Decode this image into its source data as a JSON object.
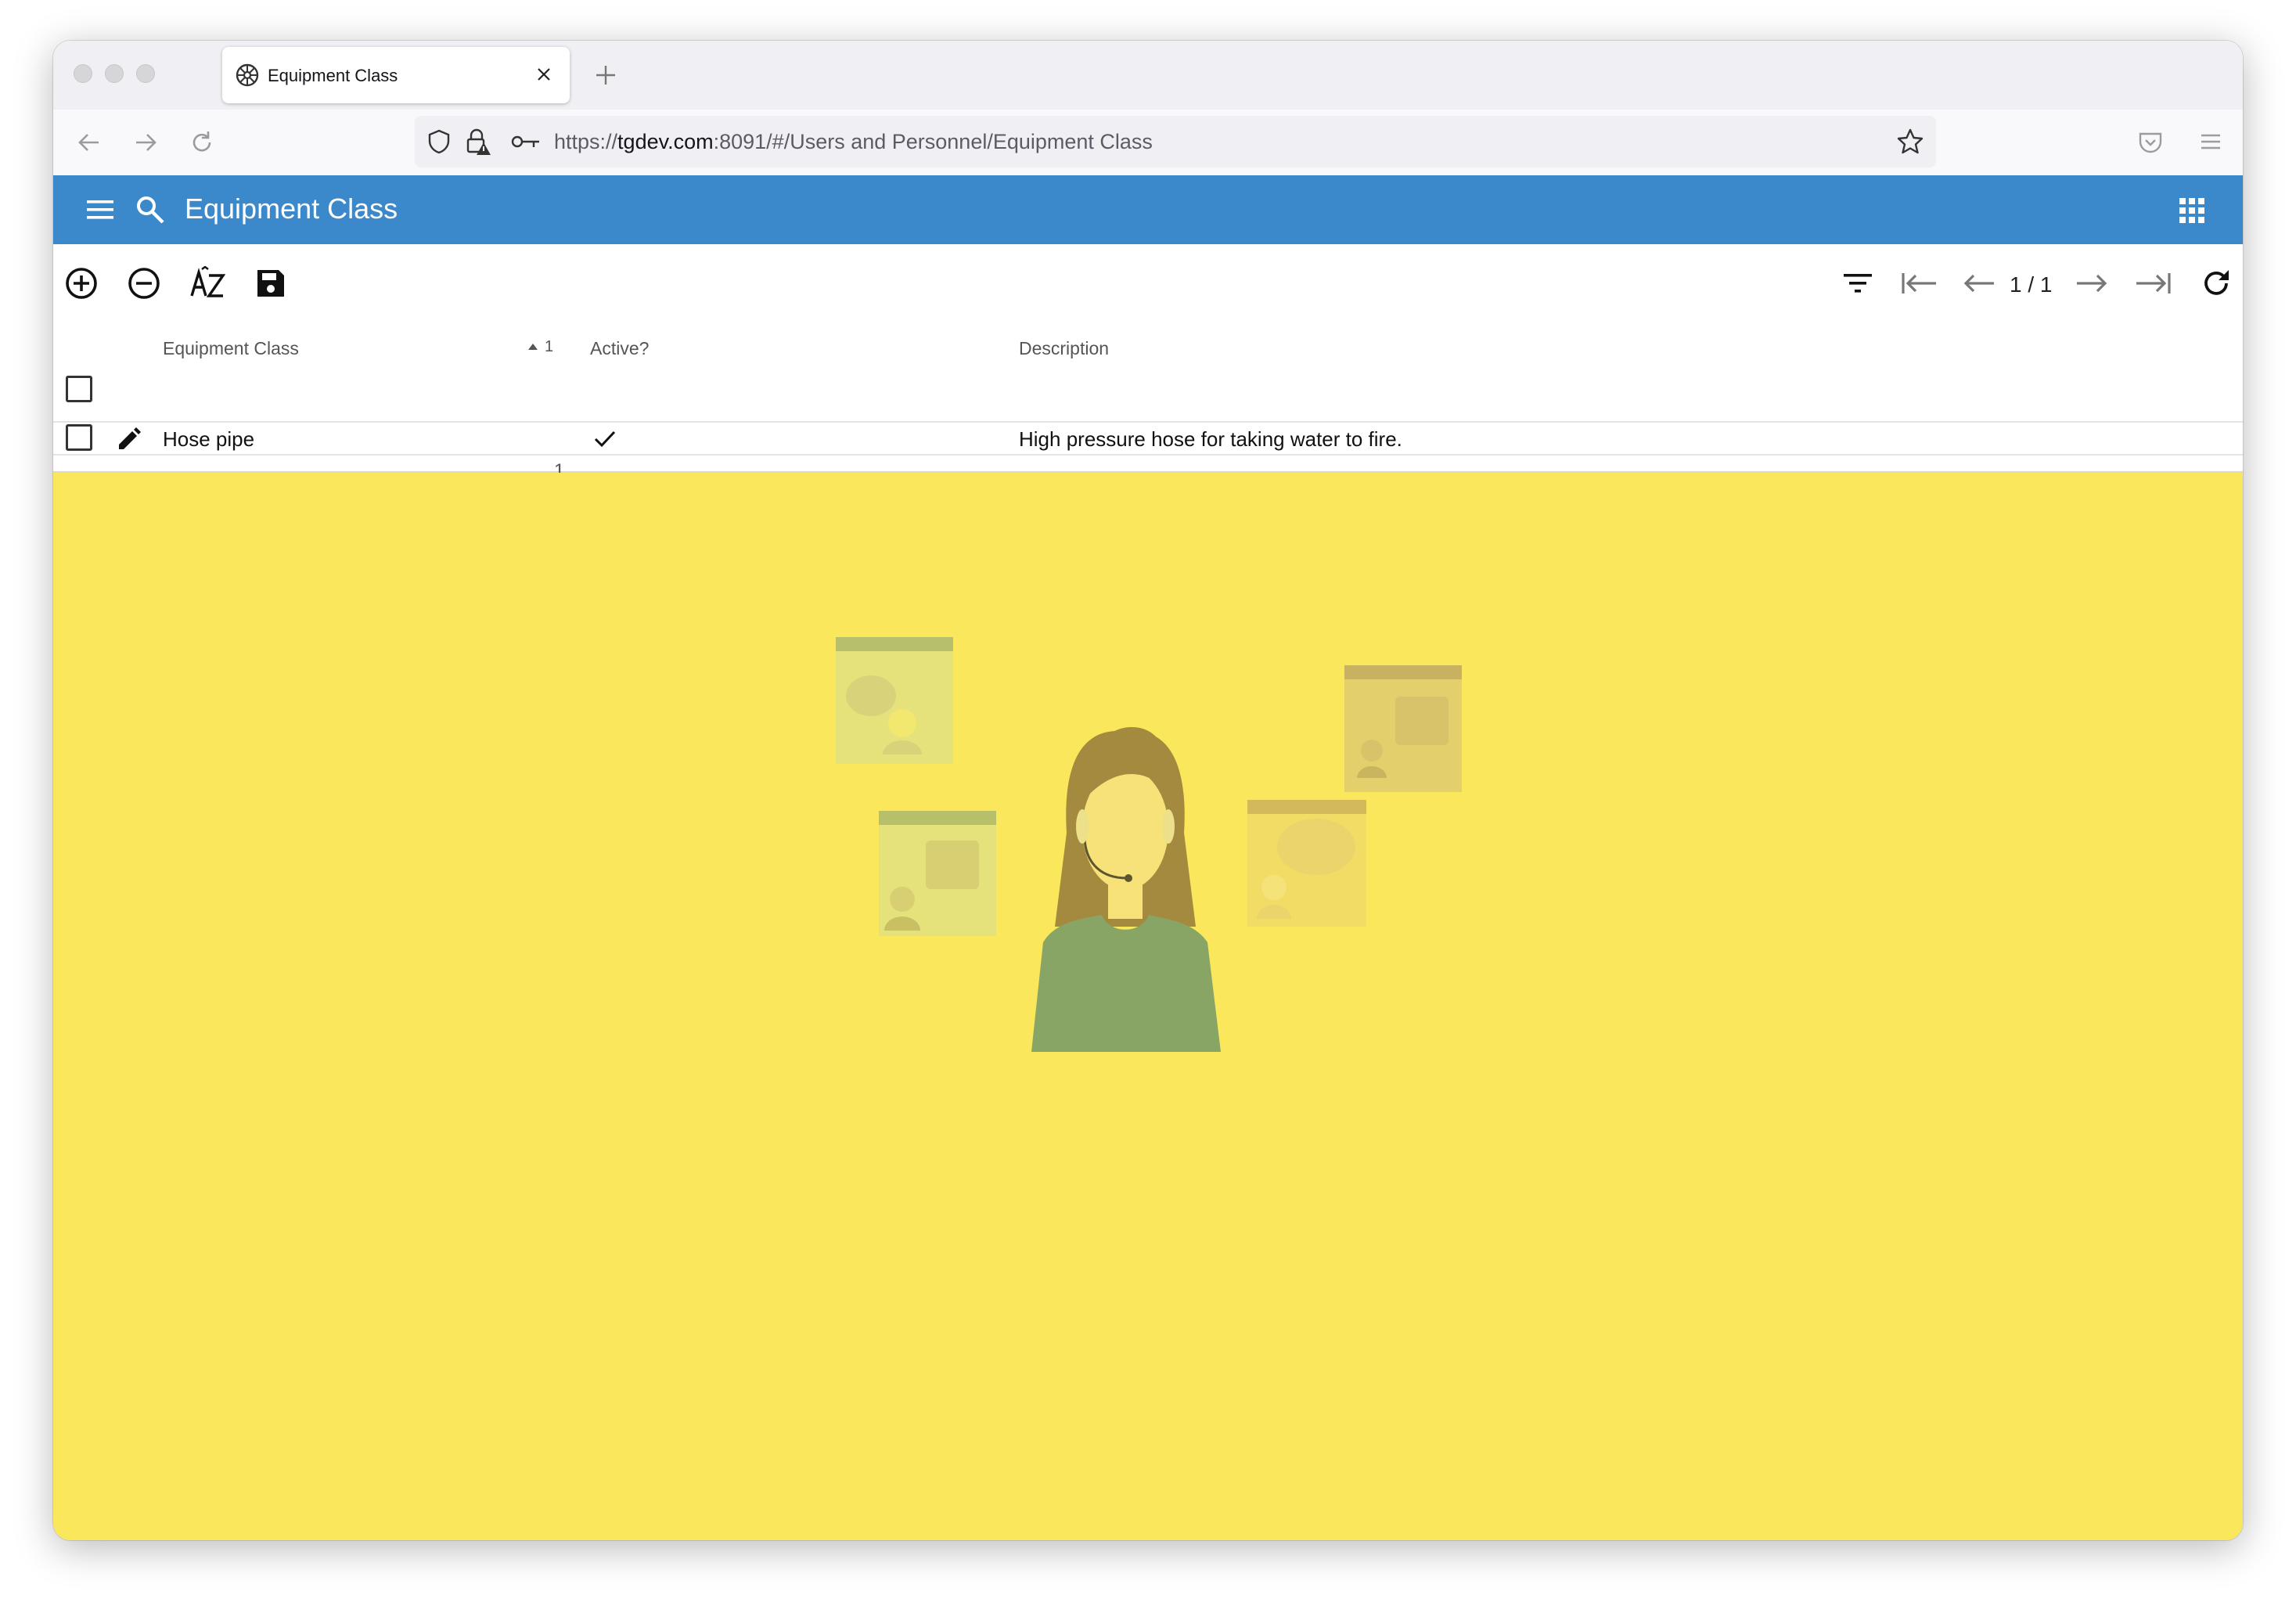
{
  "browser": {
    "tab_title": "Equipment Class",
    "url_prefix": "https://",
    "url_host": "tgdev.com",
    "url_rest": ":8091/#/Users and Personnel/Equipment Class"
  },
  "app": {
    "title": "Equipment Class",
    "header_color": "#3b88cb"
  },
  "pager": {
    "text": "1 / 1"
  },
  "table": {
    "columns": [
      "Equipment Class",
      "Active?",
      "Description"
    ],
    "sort_indicator": "1",
    "rows": [
      {
        "equipment_class": "Hose pipe",
        "active": true,
        "description": "High pressure hose for taking water to fire."
      }
    ],
    "footer_count": "1"
  },
  "icons": {
    "toolbar": [
      "add-icon",
      "remove-icon",
      "sort-az-icon",
      "save-icon"
    ],
    "pager": [
      "filter-icon",
      "first-page-icon",
      "previous-page-icon",
      "next-page-icon",
      "last-page-icon",
      "refresh-icon"
    ]
  },
  "colors": {
    "background_illustration": "#fbe75b",
    "agent_shirt": "#88a565",
    "agent_hair": "#a38a3f"
  }
}
